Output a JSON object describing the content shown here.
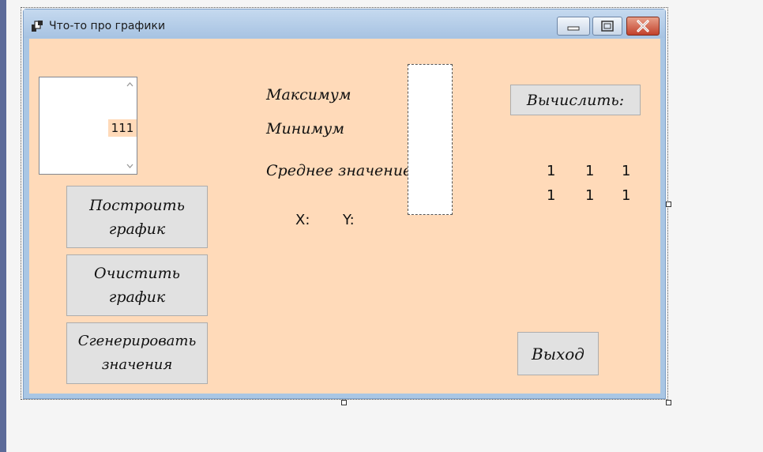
{
  "window": {
    "title": "Что-то про графики"
  },
  "list": {
    "items": [
      "111"
    ]
  },
  "buttons": {
    "plot": "Построить\nграфик",
    "clear": "Очистить\nграфик",
    "generate": "Сгенерировать\nзначения",
    "compute": "Вычислить:",
    "exit": "Выход"
  },
  "labels": {
    "max": "Максимум",
    "min": "Минимум",
    "mean": "Среднее значение",
    "x": "X:",
    "y": "Y:"
  },
  "matrix": {
    "row1": [
      "1",
      "1",
      "1"
    ],
    "row2": [
      "1",
      "1",
      "1"
    ]
  },
  "icons": {
    "app": "app-icon",
    "minimize": "minimize-icon",
    "maximize": "maximize-icon",
    "close": "close-icon",
    "scroll_up": "chevron-up-icon",
    "scroll_down": "chevron-down-icon"
  },
  "colors": {
    "client_bg": "#ffdab9",
    "button_bg": "#e1e1e1",
    "titlebar": "#a9c6e4",
    "close_button": "#c2412b"
  }
}
